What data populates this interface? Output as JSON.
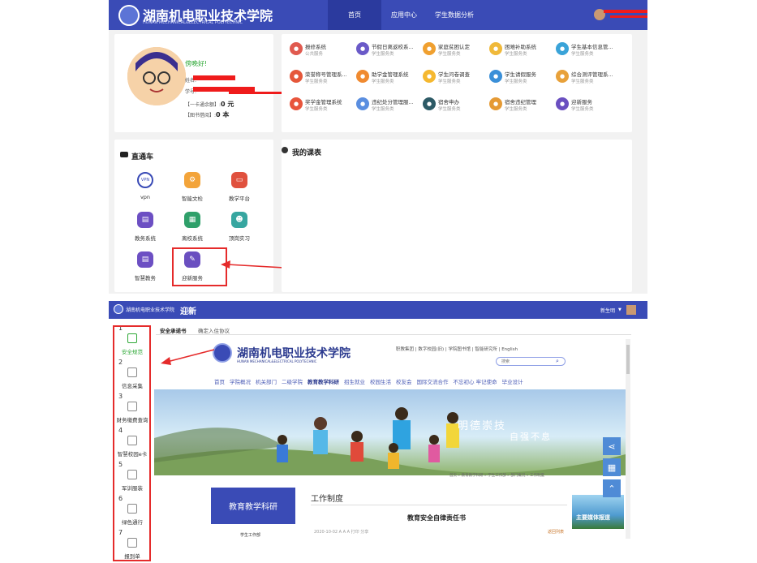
{
  "top": {
    "logo_text": "湖南机电职业技术学院",
    "logo_sub": "HUNAN MECHANICAL&ELECTRICAL POLYTECHNIC",
    "nav": [
      "首页",
      "应用中心",
      "学生数据分析"
    ]
  },
  "profile": {
    "greeting": "傍晚好!",
    "name_label": "姓名:",
    "id_label": "学号:",
    "card_label": "【一卡通余额】:",
    "card_value": "0 元",
    "book_label": "【图书借阅】:",
    "book_value": "0 本"
  },
  "apps": [
    {
      "name": "报修系统",
      "sub": "公共服务",
      "color": "#e05a4f",
      "icon": "wrench-icon"
    },
    {
      "name": "节假日离返校系...",
      "sub": "学生服务类",
      "color": "#6a5ac8",
      "icon": "calendar-icon"
    },
    {
      "name": "家庭贫困认定",
      "sub": "学生服务类",
      "color": "#f0a030",
      "icon": "home-icon"
    },
    {
      "name": "困难补助系统",
      "sub": "学生服务类",
      "color": "#f0b93a",
      "icon": "coin-icon"
    },
    {
      "name": "学生基本信息管...",
      "sub": "学生服务类",
      "color": "#3aa3d8",
      "icon": "id-card-icon"
    },
    {
      "name": "荣誉称号管理系...",
      "sub": "学生服务类",
      "color": "#e5573a",
      "icon": "medal-icon"
    },
    {
      "name": "助学金管理系统",
      "sub": "学生服务类",
      "color": "#f08a30",
      "icon": "money-icon"
    },
    {
      "name": "学生问卷调查",
      "sub": "学生服务类",
      "color": "#f5b830",
      "icon": "survey-icon"
    },
    {
      "name": "学生请假服务",
      "sub": "学生服务类",
      "color": "#3a8fd8",
      "icon": "person-icon"
    },
    {
      "name": "综合测评管理系...",
      "sub": "学生服务类",
      "color": "#e8a13a",
      "icon": "document-icon"
    },
    {
      "name": "奖学金管理系统",
      "sub": "学生服务类",
      "color": "#e8553c",
      "icon": "award-icon"
    },
    {
      "name": "违纪处分管理服...",
      "sub": "学生服务类",
      "color": "#5a8ee0",
      "icon": "warning-icon"
    },
    {
      "name": "宿舍申办",
      "sub": "学生服务类",
      "color": "#2d5a66",
      "icon": "bed-icon"
    },
    {
      "name": "宿舍违纪管理",
      "sub": "学生服务类",
      "color": "#e59a35",
      "icon": "forbid-icon"
    },
    {
      "name": "迎新服务",
      "sub": "学生服务类",
      "color": "#6a4fc0",
      "icon": "welcome-icon"
    }
  ],
  "quick": {
    "title": "直通车",
    "items": [
      {
        "label": "vpn",
        "color": "#ffffff",
        "fg": "#3a4bb6",
        "glyph": "VPN"
      },
      {
        "label": "智能文检",
        "color": "#f3a43a",
        "fg": "#fff",
        "glyph": "⚙"
      },
      {
        "label": "教学平台",
        "color": "#e0513e",
        "fg": "#fff",
        "glyph": "▭"
      },
      {
        "label": "教务系统",
        "color": "#6c4fc3",
        "fg": "#fff",
        "glyph": "▤"
      },
      {
        "label": "离校系统",
        "color": "#2fa06a",
        "fg": "#fff",
        "glyph": "▦"
      },
      {
        "label": "顶岗实习",
        "color": "#36a6a0",
        "fg": "#fff",
        "glyph": "☻"
      },
      {
        "label": "智慧教务",
        "color": "#6c4fc3",
        "fg": "#fff",
        "glyph": "▤"
      },
      {
        "label": "迎新服务",
        "color": "#6a4fc0",
        "fg": "#fff",
        "glyph": "✎"
      }
    ]
  },
  "schedule": {
    "title": "我的课表"
  },
  "portal": {
    "title": "迎新",
    "user": "新生明",
    "tabs": [
      "安全承诺书",
      "确定入住协议"
    ],
    "steps": [
      {
        "num": "1",
        "label": "安全规范"
      },
      {
        "num": "2",
        "label": "信息采集"
      },
      {
        "num": "3",
        "label": "财务缴费查询"
      },
      {
        "num": "4",
        "label": "智慧校园e卡"
      },
      {
        "num": "5",
        "label": "军训服装"
      },
      {
        "num": "6",
        "label": "绿色通行"
      },
      {
        "num": "7",
        "label": "报到单"
      }
    ],
    "site_links": "职教集团 | 数字校园(旧) | 学院图书馆 | 智能研究所 | English",
    "search_placeholder": "搜索",
    "site_nav": [
      "首页",
      "学院概况",
      "机关部门",
      "二级学院",
      "教育教学科研",
      "招生就业",
      "校园生活",
      "校友会",
      "国际交流合作",
      "不忘初心 牢记使命",
      "毕业设计"
    ],
    "slogan1": "明德崇技",
    "slogan2": "自强不息",
    "breadcrumb": "首页 » 教育教学科研 » 学生工作部 » 部门概况 » 工作制度",
    "left_panel": "教育教学科研",
    "left_sub": "学生工作部",
    "section_title": "工作制度",
    "article_title": "教育安全自律责任书",
    "meta": "2020-10-02 A A A 打印 分享",
    "back": "返回列表",
    "ad": "主要媒体报道"
  }
}
